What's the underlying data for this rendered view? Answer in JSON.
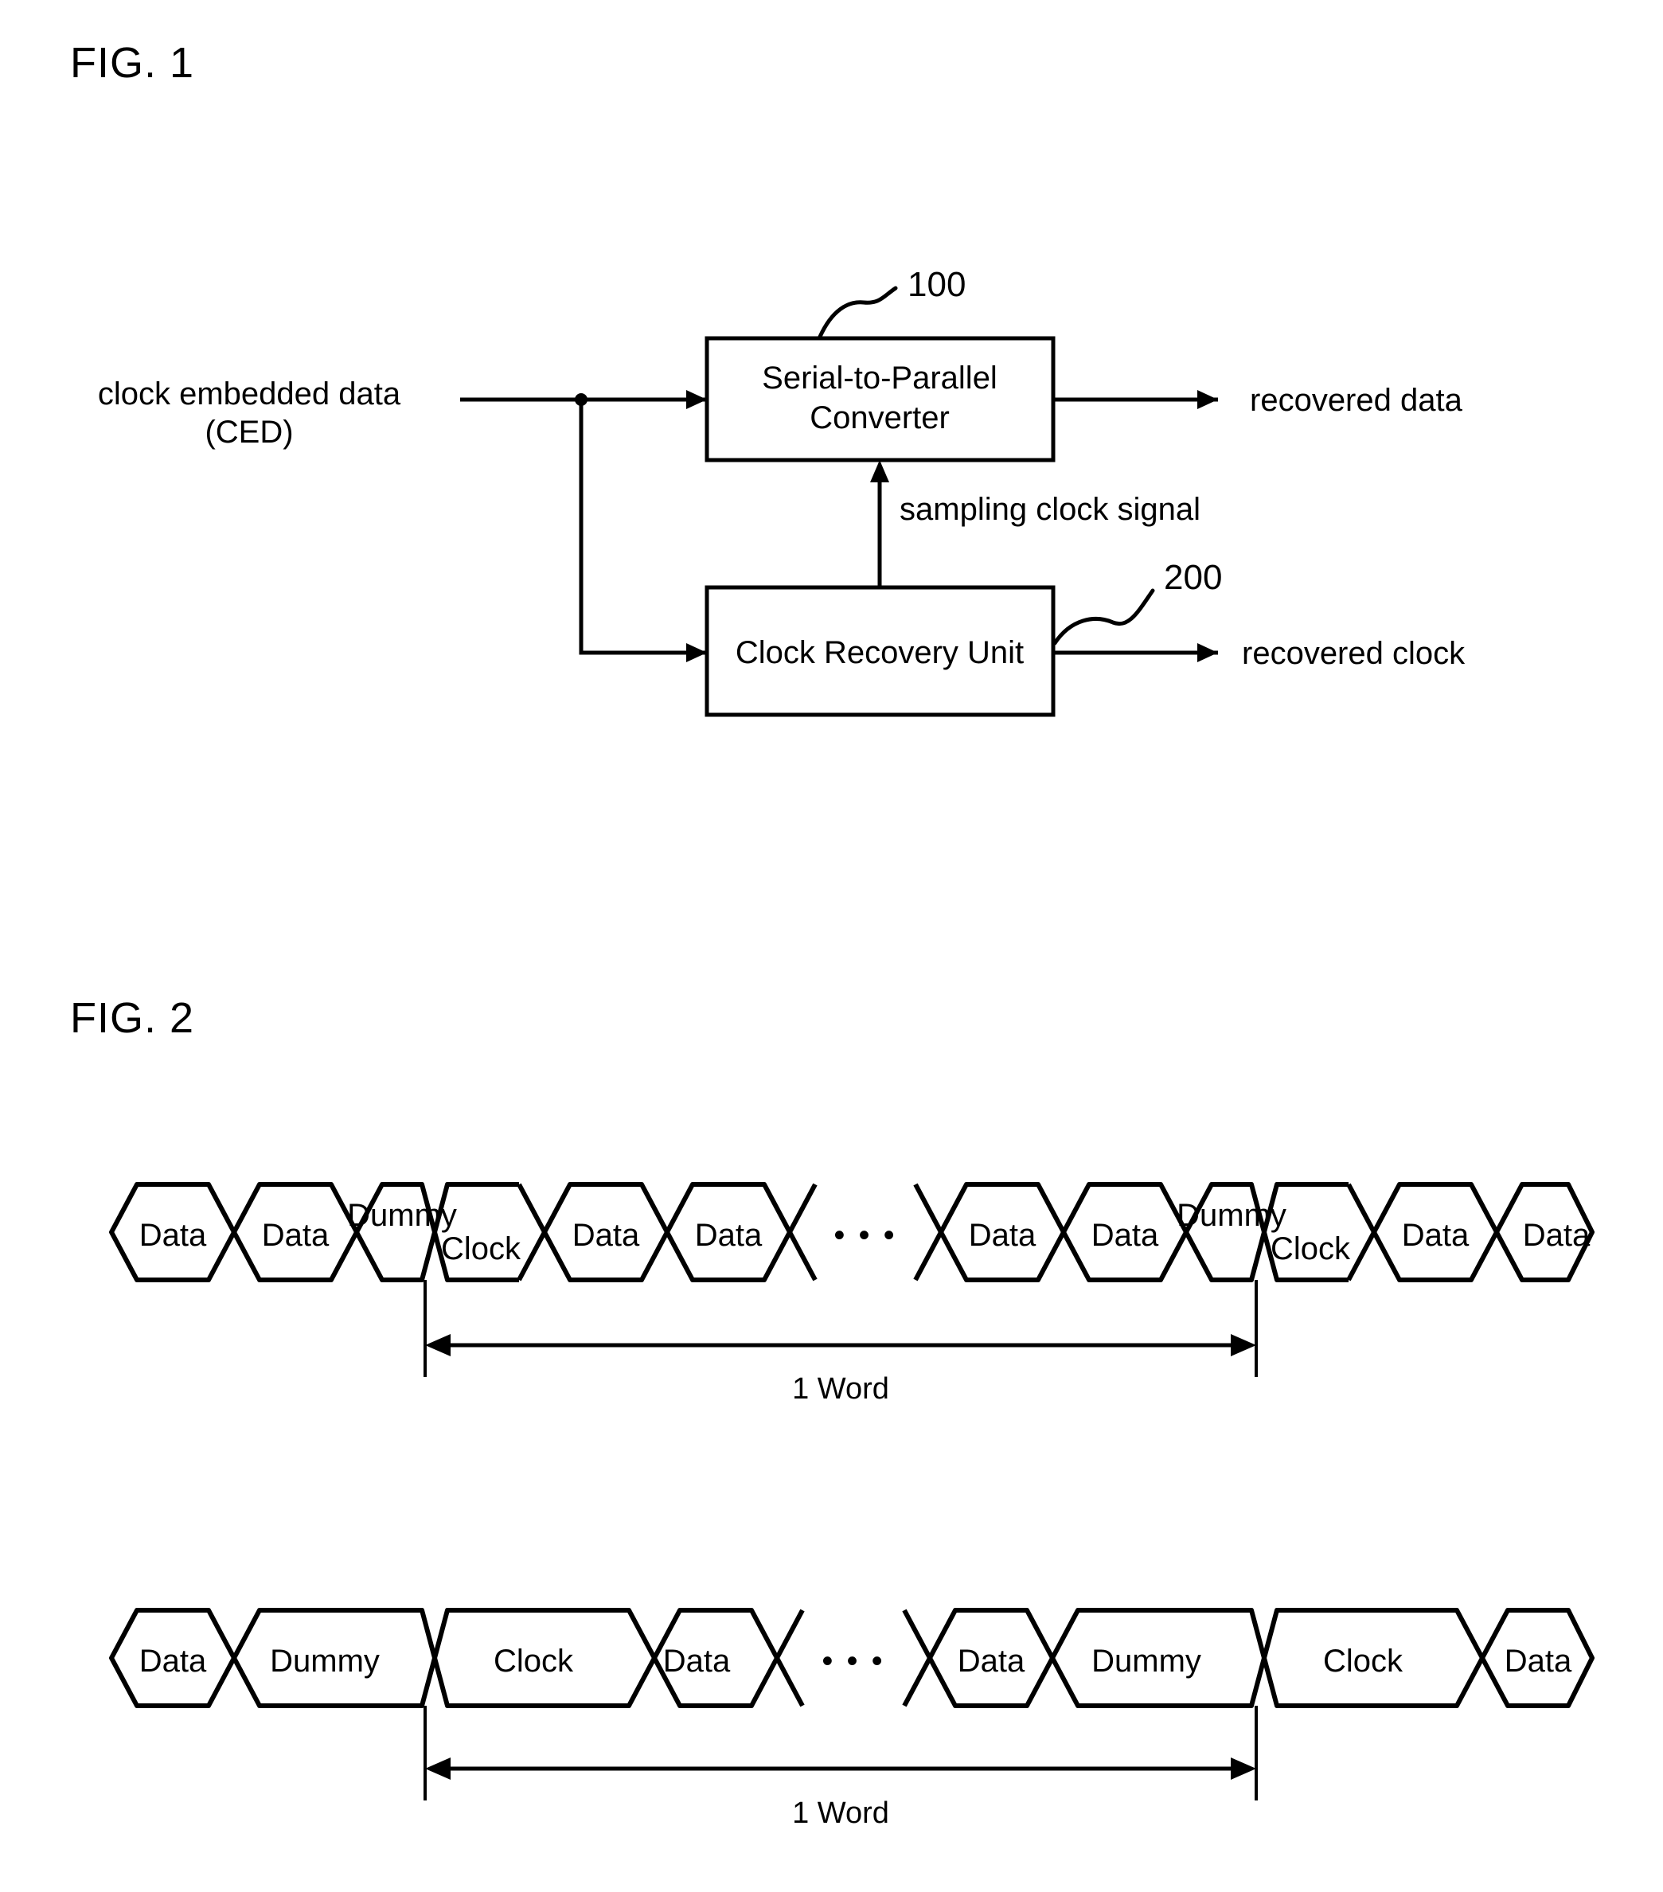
{
  "figures": [
    {
      "id": "fig1",
      "title": "FIG. 1",
      "type": "block-diagram",
      "blocks": [
        {
          "id": "stp",
          "label_line1": "Serial-to-Parallel",
          "label_line2": "Converter",
          "ref": "100"
        },
        {
          "id": "cru",
          "label_line1": "Clock Recovery Unit",
          "label_line2": "",
          "ref": "200"
        }
      ],
      "labels": {
        "input_line1": "clock embedded data",
        "input_line2": "(CED)",
        "output_data": "recovered data",
        "output_clock": "recovered clock",
        "internal_signal": "sampling clock signal"
      }
    },
    {
      "id": "fig2",
      "title": "FIG. 2",
      "type": "timing-waveform",
      "waveforms": [
        {
          "id": "waveform-top",
          "cells": [
            {
              "label": "Data",
              "kind": "data"
            },
            {
              "label": "Data",
              "kind": "data"
            },
            {
              "label": "Dummy",
              "kind": "dummy"
            },
            {
              "label": "Clock",
              "kind": "clock"
            },
            {
              "label": "Data",
              "kind": "data"
            },
            {
              "label": "Data",
              "kind": "data"
            },
            {
              "label": "• • •",
              "kind": "ellipsis"
            },
            {
              "label": "Data",
              "kind": "data"
            },
            {
              "label": "Data",
              "kind": "data"
            },
            {
              "label": "Dummy",
              "kind": "dummy"
            },
            {
              "label": "Clock",
              "kind": "clock"
            },
            {
              "label": "Data",
              "kind": "data"
            },
            {
              "label": "Data",
              "kind": "data"
            }
          ],
          "span_label": "1 Word"
        },
        {
          "id": "waveform-bottom",
          "cells": [
            {
              "label": "Data",
              "kind": "data"
            },
            {
              "label": "Dummy",
              "kind": "dummy"
            },
            {
              "label": "Clock",
              "kind": "clock"
            },
            {
              "label": "Data",
              "kind": "data"
            },
            {
              "label": "• • •",
              "kind": "ellipsis"
            },
            {
              "label": "Data",
              "kind": "data"
            },
            {
              "label": "Dummy",
              "kind": "dummy"
            },
            {
              "label": "Clock",
              "kind": "clock"
            },
            {
              "label": "Data",
              "kind": "data"
            }
          ],
          "span_label": "1 Word"
        }
      ]
    }
  ],
  "style": {
    "ink": "#000000",
    "paper": "#ffffff"
  }
}
